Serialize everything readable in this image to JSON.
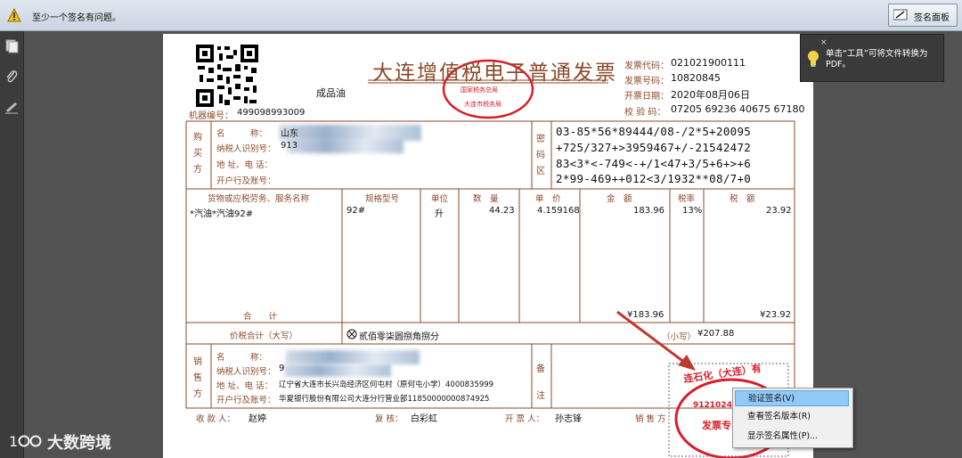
{
  "topbar": {
    "warning_text": "至少一个签名有问题。",
    "panel_button": "签名面板"
  },
  "tooltip": {
    "close": "×",
    "text": "单击“工具”可将文件转换为PDF。"
  },
  "context_menu": {
    "items": [
      "验证签名(V)",
      "查看签名版本(R)",
      "显示签名属性(P)..."
    ]
  },
  "invoice": {
    "title": "大连增值税电子普通发票",
    "subtitle": "成品油",
    "machine_label": "机器编号：",
    "machine_no": "499098993009",
    "code_label": "发票代码：",
    "code": "021021900111",
    "number_label": "发票号码：",
    "number": "10820845",
    "date_label": "开票日期：",
    "date": "2020年08月06日",
    "check_label": "校 验 码：",
    "check": "07205 69236 40675 67180",
    "buyer_side": "购买方",
    "buyer_name_label": "名　　　称：",
    "buyer_name_value": "山东",
    "buyer_tax_label": "纳税人识别号：",
    "buyer_tax_value": "913",
    "buyer_addr_label": "地 址、电 话：",
    "buyer_bank_label": "开户行及账号：",
    "cipher_side": "密码区",
    "cipher_lines": [
      "03-85*56*89444/08-/2*5+20095",
      "+725/327+>3959467+/-21542472",
      "83<3*<-749<-+/1<47+3/5+6+>+6",
      "2*99-469++012<3/1932**08/7+0"
    ],
    "headers": {
      "item": "货物或应税劳务、服务名称",
      "spec": "规格型号",
      "unit": "单位",
      "qty": "数　量",
      "price": "单　价",
      "amount": "金　额",
      "rate": "税率",
      "tax": "税　额"
    },
    "row": {
      "item": "*汽油*汽油92#",
      "spec": "92#",
      "unit": "升",
      "qty": "44.23",
      "price": "4.159168",
      "amount": "183.96",
      "rate": "13%",
      "tax": "23.92"
    },
    "total_label": "合　　计",
    "total_amount": "¥183.96",
    "total_tax": "¥23.92",
    "sum_label": "价税合计（大写）",
    "sum_words": "贰佰零柒圆捌角捌分",
    "sum_small_label": "（小写）",
    "sum_small": "¥207.88",
    "seller_side": "销售方",
    "seller_name_label": "名　　　称：",
    "seller_tax_label": "纳税人识别号：",
    "seller_tax_value": "9",
    "seller_addr_label": "地 址、电 话：",
    "seller_addr_value": "辽宁省大连市长兴岛经济区何屯村（原何屯小学）4000835999",
    "seller_bank_label": "开户行及账号：",
    "seller_bank_value": "华夏银行股份有限公司大连分行营业部11850000000874925",
    "remark_side": "备注",
    "payee_label": "收 款 人：",
    "payee": "赵婷",
    "reviewer_label": "复 核：",
    "reviewer": "白彩虹",
    "drawer_label": "开 票 人：",
    "drawer": "孙志锋",
    "seller_sign_label": "销 售 方",
    "stamp_top": "国家税务总局",
    "stamp_bottom": "大连市税务局",
    "seller_stamp_text": "连石化（大连）有",
    "seller_stamp_no": "91210244M",
    "seller_stamp_bottom": "发票专"
  },
  "watermark": {
    "text": "大数跨境"
  },
  "colors": {
    "invoice_brown": "#8b4a2a",
    "stamp_red": "#d81e2a",
    "menu_highlight": "#91c9f7"
  }
}
